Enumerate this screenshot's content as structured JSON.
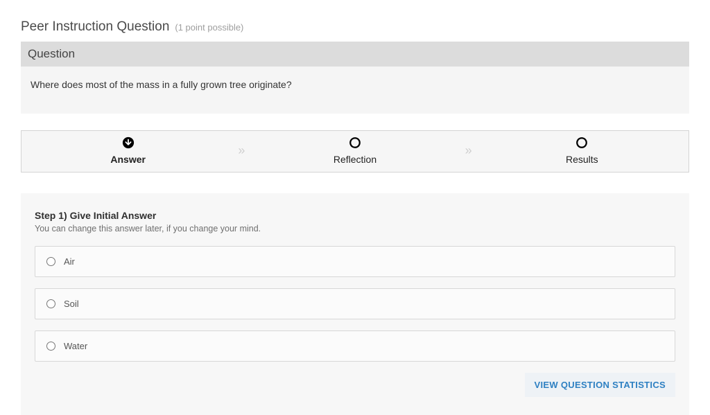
{
  "header": {
    "title": "Peer Instruction Question",
    "points": "(1 point possible)"
  },
  "question": {
    "section_label": "Question",
    "text": "Where does most of the mass in a fully grown tree originate?"
  },
  "stepper": {
    "steps": [
      {
        "label": "Answer",
        "icon": "circle-down-arrow-icon",
        "active": true
      },
      {
        "label": "Reflection",
        "icon": "circle-outline-icon",
        "active": false
      },
      {
        "label": "Results",
        "icon": "circle-outline-icon",
        "active": false
      }
    ]
  },
  "panel": {
    "step_title": "Step 1) Give Initial Answer",
    "step_hint": "You can change this answer later, if you change your mind.",
    "choices": [
      {
        "label": "Air"
      },
      {
        "label": "Soil"
      },
      {
        "label": "Water"
      }
    ],
    "stats_button": "VIEW QUESTION STATISTICS"
  }
}
